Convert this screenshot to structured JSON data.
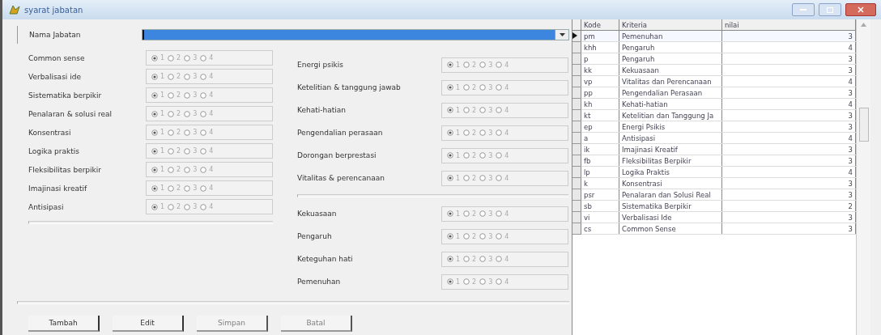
{
  "window": {
    "title": "syarat jabatan"
  },
  "nama_jabatan": {
    "label": "Nama Jabatan",
    "focused": true
  },
  "criteria_left": [
    {
      "label": "Common sense",
      "options": [
        {
          "label": "1",
          "selected": true
        },
        {
          "label": "2",
          "selected": false
        },
        {
          "label": "3",
          "selected": false
        },
        {
          "label": "4",
          "selected": false
        }
      ]
    },
    {
      "label": "Verbalisasi ide",
      "options": [
        {
          "label": "1",
          "selected": true
        },
        {
          "label": "2",
          "selected": false
        },
        {
          "label": "3",
          "selected": false
        },
        {
          "label": "4",
          "selected": false
        }
      ]
    },
    {
      "label": "Sistematika berpikir",
      "options": [
        {
          "label": "1",
          "selected": true
        },
        {
          "label": "2",
          "selected": false
        },
        {
          "label": "3",
          "selected": false
        },
        {
          "label": "4",
          "selected": false
        }
      ]
    },
    {
      "label": "Penalaran & solusi real",
      "options": [
        {
          "label": "1",
          "selected": true
        },
        {
          "label": "2",
          "selected": false
        },
        {
          "label": "3",
          "selected": false
        },
        {
          "label": "4",
          "selected": false
        }
      ]
    },
    {
      "label": "Konsentrasi",
      "options": [
        {
          "label": "1",
          "selected": true
        },
        {
          "label": "2",
          "selected": false
        },
        {
          "label": "3",
          "selected": false
        },
        {
          "label": "4",
          "selected": false
        }
      ]
    },
    {
      "label": "Logika praktis",
      "options": [
        {
          "label": "1",
          "selected": true
        },
        {
          "label": "2",
          "selected": false
        },
        {
          "label": "3",
          "selected": false
        },
        {
          "label": "4",
          "selected": false
        }
      ]
    },
    {
      "label": "Fleksibilitas berpikir",
      "options": [
        {
          "label": "1",
          "selected": true
        },
        {
          "label": "2",
          "selected": false
        },
        {
          "label": "3",
          "selected": false
        },
        {
          "label": "4",
          "selected": false
        }
      ]
    },
    {
      "label": "Imajinasi kreatif",
      "options": [
        {
          "label": "1",
          "selected": true
        },
        {
          "label": "2",
          "selected": false
        },
        {
          "label": "3",
          "selected": false
        },
        {
          "label": "4",
          "selected": false
        }
      ]
    },
    {
      "label": "Antisipasi",
      "options": [
        {
          "label": "1",
          "selected": true
        },
        {
          "label": "2",
          "selected": false
        },
        {
          "label": "3",
          "selected": false
        },
        {
          "label": "4",
          "selected": false
        }
      ]
    }
  ],
  "criteria_right": [
    {
      "label": "Energi psikis",
      "options": [
        {
          "label": "1",
          "selected": true
        },
        {
          "label": "2",
          "selected": false
        },
        {
          "label": "3",
          "selected": false
        },
        {
          "label": "4",
          "selected": false
        }
      ]
    },
    {
      "label": "Ketelitian & tanggung jawab",
      "options": [
        {
          "label": "1",
          "selected": true
        },
        {
          "label": "2",
          "selected": false
        },
        {
          "label": "3",
          "selected": false
        },
        {
          "label": "4",
          "selected": false
        }
      ]
    },
    {
      "label": "Kehati-hatian",
      "options": [
        {
          "label": "1",
          "selected": true
        },
        {
          "label": "2",
          "selected": false
        },
        {
          "label": "3",
          "selected": false
        },
        {
          "label": "4",
          "selected": false
        }
      ]
    },
    {
      "label": "Pengendalian perasaan",
      "options": [
        {
          "label": "1",
          "selected": true
        },
        {
          "label": "2",
          "selected": false
        },
        {
          "label": "3",
          "selected": false
        },
        {
          "label": "4",
          "selected": false
        }
      ]
    },
    {
      "label": "Dorongan berprestasi",
      "options": [
        {
          "label": "1",
          "selected": true
        },
        {
          "label": "2",
          "selected": false
        },
        {
          "label": "3",
          "selected": false
        },
        {
          "label": "4",
          "selected": false
        }
      ]
    },
    {
      "label": "Vitalitas & perencanaan",
      "options": [
        {
          "label": "1",
          "selected": true
        },
        {
          "label": "2",
          "selected": false
        },
        {
          "label": "3",
          "selected": false
        },
        {
          "label": "4",
          "selected": false
        }
      ]
    }
  ],
  "criteria_right_2": [
    {
      "label": "Kekuasaan",
      "options": [
        {
          "label": "1",
          "selected": true
        },
        {
          "label": "2",
          "selected": false
        },
        {
          "label": "3",
          "selected": false
        },
        {
          "label": "4",
          "selected": false
        }
      ]
    },
    {
      "label": "Pengaruh",
      "options": [
        {
          "label": "1",
          "selected": true
        },
        {
          "label": "2",
          "selected": false
        },
        {
          "label": "3",
          "selected": false
        },
        {
          "label": "4",
          "selected": false
        }
      ]
    },
    {
      "label": "Keteguhan hati",
      "options": [
        {
          "label": "1",
          "selected": true
        },
        {
          "label": "2",
          "selected": false
        },
        {
          "label": "3",
          "selected": false
        },
        {
          "label": "4",
          "selected": false
        }
      ]
    },
    {
      "label": "Pemenuhan",
      "options": [
        {
          "label": "1",
          "selected": true
        },
        {
          "label": "2",
          "selected": false
        },
        {
          "label": "3",
          "selected": false
        },
        {
          "label": "4",
          "selected": false
        }
      ]
    }
  ],
  "buttons": [
    {
      "label": "Tambah",
      "disabled": false
    },
    {
      "label": "Edit",
      "disabled": false
    },
    {
      "label": "Simpan",
      "disabled": true
    },
    {
      "label": "Batal",
      "disabled": true
    }
  ],
  "table": {
    "columns": [
      "Kode",
      "Kriteria",
      "nilai"
    ],
    "rows": [
      {
        "kode": "pm",
        "kriteria": "Pemenuhan",
        "nilai": "3",
        "selected": true
      },
      {
        "kode": "khh",
        "kriteria": "Pengaruh",
        "nilai": "4",
        "selected": false
      },
      {
        "kode": "p",
        "kriteria": "Pengaruh",
        "nilai": "3",
        "selected": false
      },
      {
        "kode": "kk",
        "kriteria": "Kekuasaan",
        "nilai": "3",
        "selected": false
      },
      {
        "kode": "vp",
        "kriteria": "Vitalitas dan Perencanaan",
        "nilai": "4",
        "selected": false
      },
      {
        "kode": "pp",
        "kriteria": "Pengendalian Perasaan",
        "nilai": "3",
        "selected": false
      },
      {
        "kode": "kh",
        "kriteria": "Kehati-hatian",
        "nilai": "4",
        "selected": false
      },
      {
        "kode": "kt",
        "kriteria": "Ketelitian dan Tanggung Ja",
        "nilai": "3",
        "selected": false
      },
      {
        "kode": "ep",
        "kriteria": "Energi Psikis",
        "nilai": "3",
        "selected": false
      },
      {
        "kode": "a",
        "kriteria": "Antisipasi",
        "nilai": "4",
        "selected": false
      },
      {
        "kode": "ik",
        "kriteria": "Imajinasi Kreatif",
        "nilai": "3",
        "selected": false
      },
      {
        "kode": "fb",
        "kriteria": "Fleksibilitas Berpikir",
        "nilai": "3",
        "selected": false
      },
      {
        "kode": "lp",
        "kriteria": "Logika Praktis",
        "nilai": "4",
        "selected": false
      },
      {
        "kode": "k",
        "kriteria": "Konsentrasi",
        "nilai": "3",
        "selected": false
      },
      {
        "kode": "psr",
        "kriteria": "Penalaran dan Solusi Real",
        "nilai": "3",
        "selected": false
      },
      {
        "kode": "sb",
        "kriteria": "Sistematika Berpikir",
        "nilai": "2",
        "selected": false
      },
      {
        "kode": "vi",
        "kriteria": "Verbalisasi Ide",
        "nilai": "3",
        "selected": false
      },
      {
        "kode": "cs",
        "kriteria": "Common Sense",
        "nilai": "3",
        "selected": false
      }
    ]
  }
}
